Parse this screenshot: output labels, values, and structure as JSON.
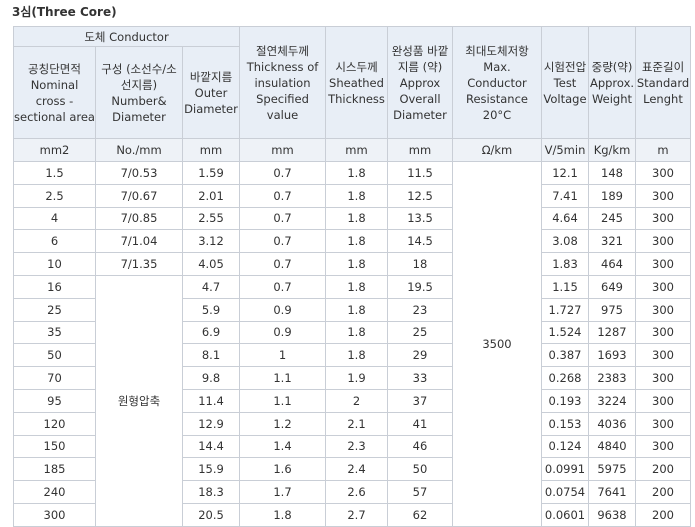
{
  "title": "3심(Three Core)",
  "headers": {
    "conductor_group": "도체 Conductor",
    "area": "공칭단면적 Nominal cross -sectional area",
    "composition": "구성 (소선수/소선지름) Number& Diameter",
    "outer_diameter": "바깥지름 Outer Diameter",
    "insulation": "절연체두께 Thickness of insulation Specified value",
    "sheath": "시스두께 Sheathed Thickness",
    "overall": "완성품 바깥지름 (약) Approx Overall Diameter",
    "resistance": "최대도체저항 Max. Conductor Resistance 20°C",
    "voltage": "시험전압 Test Voltage",
    "weight": "중량(약) Approx. Weight",
    "length": "표준길이 Standard Lenght"
  },
  "units": [
    "mm2",
    "No./mm",
    "mm",
    "mm",
    "mm",
    "mm",
    "Ω/km",
    "V/5min",
    "Kg/km",
    "m"
  ],
  "resistance_value": "3500",
  "compressed_label": "원형압축",
  "rows": [
    {
      "area": "1.5",
      "composition": "7/0.53",
      "outer": "1.59",
      "insulation": "0.7",
      "sheath": "1.8",
      "overall": "11.5",
      "voltage": "12.1",
      "weight": "148",
      "length": "300"
    },
    {
      "area": "2.5",
      "composition": "7/0.67",
      "outer": "2.01",
      "insulation": "0.7",
      "sheath": "1.8",
      "overall": "12.5",
      "voltage": "7.41",
      "weight": "189",
      "length": "300"
    },
    {
      "area": "4",
      "composition": "7/0.85",
      "outer": "2.55",
      "insulation": "0.7",
      "sheath": "1.8",
      "overall": "13.5",
      "voltage": "4.64",
      "weight": "245",
      "length": "300"
    },
    {
      "area": "6",
      "composition": "7/1.04",
      "outer": "3.12",
      "insulation": "0.7",
      "sheath": "1.8",
      "overall": "14.5",
      "voltage": "3.08",
      "weight": "321",
      "length": "300"
    },
    {
      "area": "10",
      "composition": "7/1.35",
      "outer": "4.05",
      "insulation": "0.7",
      "sheath": "1.8",
      "overall": "18",
      "voltage": "1.83",
      "weight": "464",
      "length": "300"
    },
    {
      "area": "16",
      "composition": "",
      "outer": "4.7",
      "insulation": "0.7",
      "sheath": "1.8",
      "overall": "19.5",
      "voltage": "1.15",
      "weight": "649",
      "length": "300"
    },
    {
      "area": "25",
      "composition": "",
      "outer": "5.9",
      "insulation": "0.9",
      "sheath": "1.8",
      "overall": "23",
      "voltage": "1.727",
      "weight": "975",
      "length": "300"
    },
    {
      "area": "35",
      "composition": "",
      "outer": "6.9",
      "insulation": "0.9",
      "sheath": "1.8",
      "overall": "25",
      "voltage": "1.524",
      "weight": "1287",
      "length": "300"
    },
    {
      "area": "50",
      "composition": "",
      "outer": "8.1",
      "insulation": "1",
      "sheath": "1.8",
      "overall": "29",
      "voltage": "0.387",
      "weight": "1693",
      "length": "300"
    },
    {
      "area": "70",
      "composition": "",
      "outer": "9.8",
      "insulation": "1.1",
      "sheath": "1.9",
      "overall": "33",
      "voltage": "0.268",
      "weight": "2383",
      "length": "300"
    },
    {
      "area": "95",
      "composition": "",
      "outer": "11.4",
      "insulation": "1.1",
      "sheath": "2",
      "overall": "37",
      "voltage": "0.193",
      "weight": "3224",
      "length": "300"
    },
    {
      "area": "120",
      "composition": "",
      "outer": "12.9",
      "insulation": "1.2",
      "sheath": "2.1",
      "overall": "41",
      "voltage": "0.153",
      "weight": "4036",
      "length": "300"
    },
    {
      "area": "150",
      "composition": "",
      "outer": "14.4",
      "insulation": "1.4",
      "sheath": "2.3",
      "overall": "46",
      "voltage": "0.124",
      "weight": "4840",
      "length": "300"
    },
    {
      "area": "185",
      "composition": "",
      "outer": "15.9",
      "insulation": "1.6",
      "sheath": "2.4",
      "overall": "50",
      "voltage": "0.0991",
      "weight": "5975",
      "length": "200"
    },
    {
      "area": "240",
      "composition": "",
      "outer": "18.3",
      "insulation": "1.7",
      "sheath": "2.6",
      "overall": "57",
      "voltage": "0.0754",
      "weight": "7641",
      "length": "200"
    },
    {
      "area": "300",
      "composition": "",
      "outer": "20.5",
      "insulation": "1.8",
      "sheath": "2.7",
      "overall": "62",
      "voltage": "0.0601",
      "weight": "9638",
      "length": "200"
    }
  ]
}
